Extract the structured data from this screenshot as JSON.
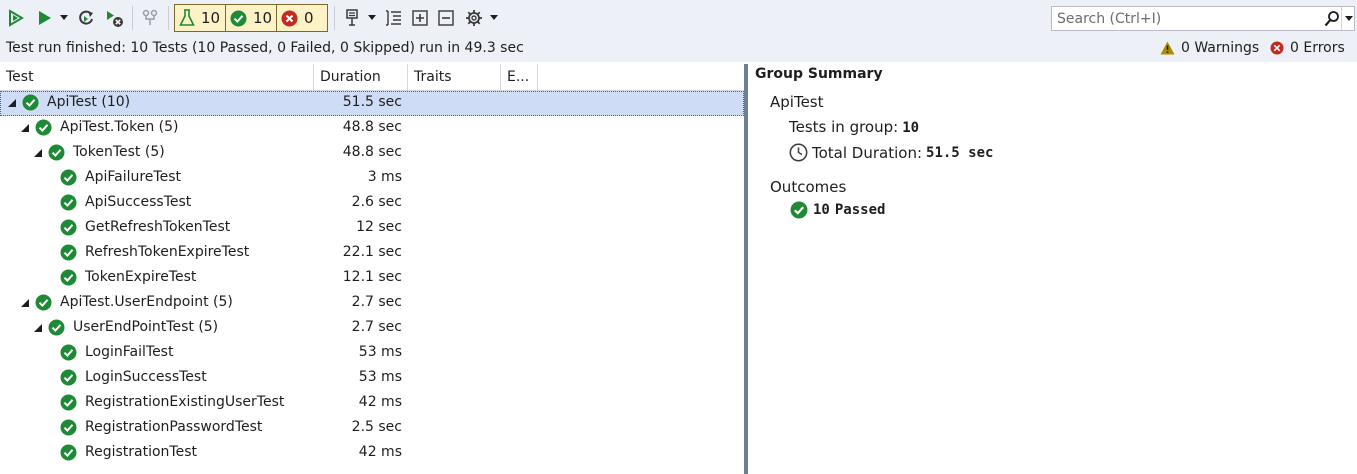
{
  "toolbar": {
    "filters": [
      {
        "name": "all",
        "count": "10",
        "icon": "flask-icon"
      },
      {
        "name": "passed",
        "count": "10",
        "icon": "passed-icon"
      },
      {
        "name": "failed",
        "count": "0",
        "icon": "failed-icon"
      }
    ],
    "search_placeholder": "Search (Ctrl+I)"
  },
  "status": {
    "text": "Test run finished: 10 Tests (10 Passed, 0 Failed, 0 Skipped) run in 49.3 sec",
    "warnings": "0 Warnings",
    "errors": "0 Errors"
  },
  "columns": [
    "Test",
    "Duration",
    "Traits",
    "E..."
  ],
  "tests": [
    {
      "name": "ApiTest",
      "count": "(10)",
      "duration": "51.5 sec",
      "level": 0,
      "expanded": true,
      "selected": true
    },
    {
      "name": "ApiTest.Token",
      "count": "(5)",
      "duration": "48.8 sec",
      "level": 1,
      "expanded": true
    },
    {
      "name": "TokenTest",
      "count": "(5)",
      "duration": "48.8 sec",
      "level": 2,
      "expanded": true
    },
    {
      "name": "ApiFailureTest",
      "count": "",
      "duration": "3 ms",
      "level": 3
    },
    {
      "name": "ApiSuccessTest",
      "count": "",
      "duration": "2.6 sec",
      "level": 3
    },
    {
      "name": "GetRefreshTokenTest",
      "count": "",
      "duration": "12 sec",
      "level": 3
    },
    {
      "name": "RefreshTokenExpireTest",
      "count": "",
      "duration": "22.1 sec",
      "level": 3
    },
    {
      "name": "TokenExpireTest",
      "count": "",
      "duration": "12.1 sec",
      "level": 3
    },
    {
      "name": "ApiTest.UserEndpoint",
      "count": "(5)",
      "duration": "2.7 sec",
      "level": 1,
      "expanded": true
    },
    {
      "name": "UserEndPointTest",
      "count": "(5)",
      "duration": "2.7 sec",
      "level": 2,
      "expanded": true
    },
    {
      "name": "LoginFailTest",
      "count": "",
      "duration": "53 ms",
      "level": 3
    },
    {
      "name": "LoginSuccessTest",
      "count": "",
      "duration": "53 ms",
      "level": 3
    },
    {
      "name": "RegistrationExistingUserTest",
      "count": "",
      "duration": "42 ms",
      "level": 3
    },
    {
      "name": "RegistrationPasswordTest",
      "count": "",
      "duration": "2.5 sec",
      "level": 3
    },
    {
      "name": "RegistrationTest",
      "count": "",
      "duration": "42 ms",
      "level": 3
    }
  ],
  "summary": {
    "title": "Group Summary",
    "group": "ApiTest",
    "tests_label": "Tests in group:",
    "tests_value": "10",
    "duration_label": "Total Duration:",
    "duration_value": "51.5 sec",
    "outcomes_label": "Outcomes",
    "passed_count": "10",
    "passed_label": "Passed"
  },
  "colors": {
    "pass": "#1e8a36",
    "fail": "#c42b1c",
    "warning": "#b08a00",
    "accent": "#1e6fbf"
  }
}
